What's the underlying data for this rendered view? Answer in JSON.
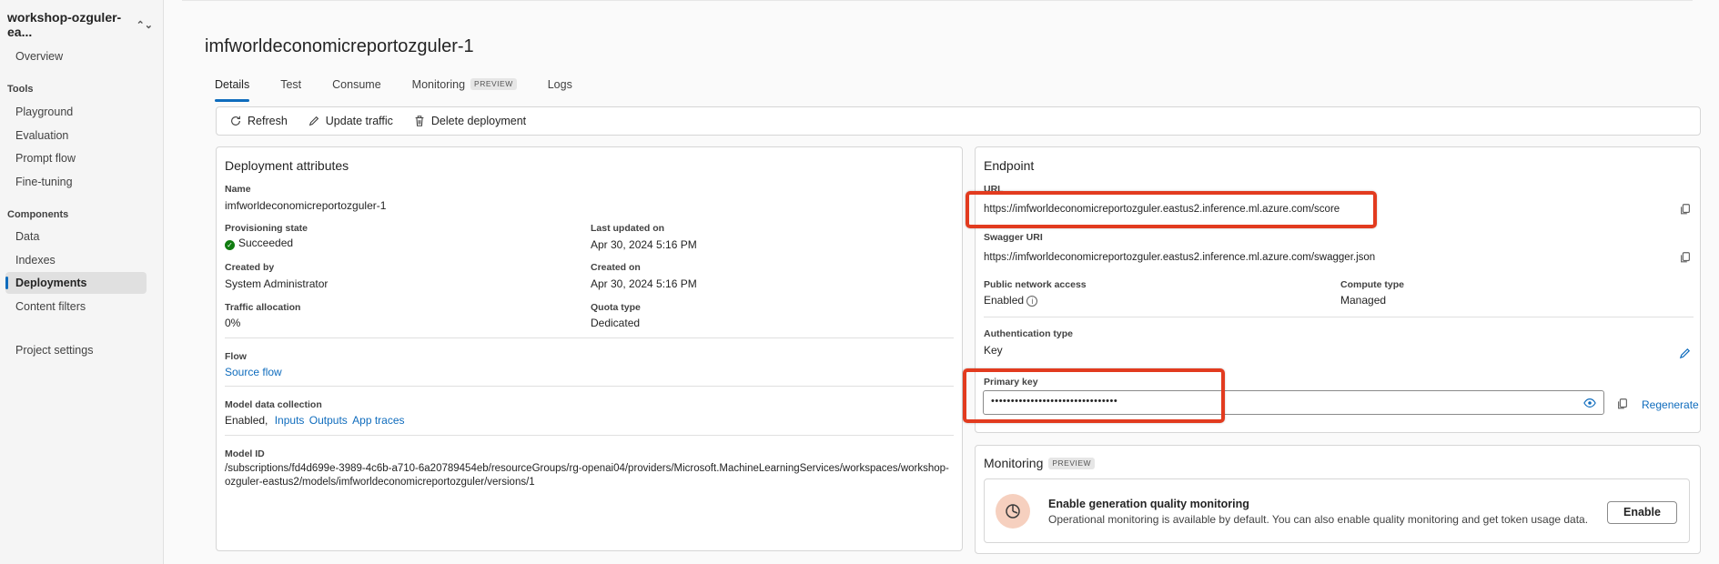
{
  "sidebar": {
    "project": "workshop-ozguler-ea...",
    "overview": "Overview",
    "tools_header": "Tools",
    "tools": [
      "Playground",
      "Evaluation",
      "Prompt flow",
      "Fine-tuning"
    ],
    "components_header": "Components",
    "components": [
      "Data",
      "Indexes",
      "Deployments",
      "Content filters"
    ],
    "active_item": "Deployments",
    "settings": "Project settings"
  },
  "page": {
    "title": "imfworldeconomicreportozguler-1",
    "tabs": [
      {
        "label": "Details",
        "active": true
      },
      {
        "label": "Test"
      },
      {
        "label": "Consume"
      },
      {
        "label": "Monitoring",
        "badge": "PREVIEW"
      },
      {
        "label": "Logs"
      }
    ]
  },
  "toolbar": {
    "refresh": "Refresh",
    "update_traffic": "Update traffic",
    "delete_deployment": "Delete deployment"
  },
  "deployment": {
    "heading": "Deployment attributes",
    "name_label": "Name",
    "name": "imfworldeconomicreportozguler-1",
    "provisioning_label": "Provisioning state",
    "provisioning": "Succeeded",
    "last_updated_label": "Last updated on",
    "last_updated": "Apr 30, 2024 5:16 PM",
    "created_by_label": "Created by",
    "created_by": "System Administrator",
    "created_on_label": "Created on",
    "created_on": "Apr 30, 2024 5:16 PM",
    "traffic_label": "Traffic allocation",
    "traffic": "0%",
    "quota_label": "Quota type",
    "quota": "Dedicated",
    "flow_label": "Flow",
    "flow_link": "Source flow",
    "mdc_label": "Model data collection",
    "mdc_state": "Enabled,",
    "mdc_links": [
      "Inputs",
      "Outputs",
      "App traces"
    ],
    "model_id_label": "Model ID",
    "model_id_line1": "/subscriptions/fd4d699e-3989-4c6b-a710-6a20789454eb/resourceGroups/rg-openai04/providers/Microsoft.MachineLearningServices/workspaces/workshop-",
    "model_id_line2": "ozguler-eastus2/models/imfworldeconomicreportozguler/versions/1"
  },
  "endpoint": {
    "heading": "Endpoint",
    "url_label": "URL",
    "url": "https://imfworldeconomicreportozguler.eastus2.inference.ml.azure.com/score",
    "swagger_label": "Swagger URI",
    "swagger": "https://imfworldeconomicreportozguler.eastus2.inference.ml.azure.com/swagger.json",
    "public_label": "Public network access",
    "public": "Enabled",
    "compute_label": "Compute type",
    "compute": "Managed",
    "auth_label": "Authentication type",
    "auth": "Key",
    "primary_key_label": "Primary key",
    "primary_key_masked": "••••••••••••••••••••••••••••••••",
    "regenerate": "Regenerate"
  },
  "monitoring": {
    "heading": "Monitoring",
    "badge": "PREVIEW",
    "title": "Enable generation quality monitoring",
    "desc": "Operational monitoring is available by default. You can also enable quality monitoring and get token usage data.",
    "enable": "Enable"
  },
  "colors": {
    "accent": "#0f6cbd",
    "highlight": "#e23b1f",
    "success": "#107c10"
  }
}
